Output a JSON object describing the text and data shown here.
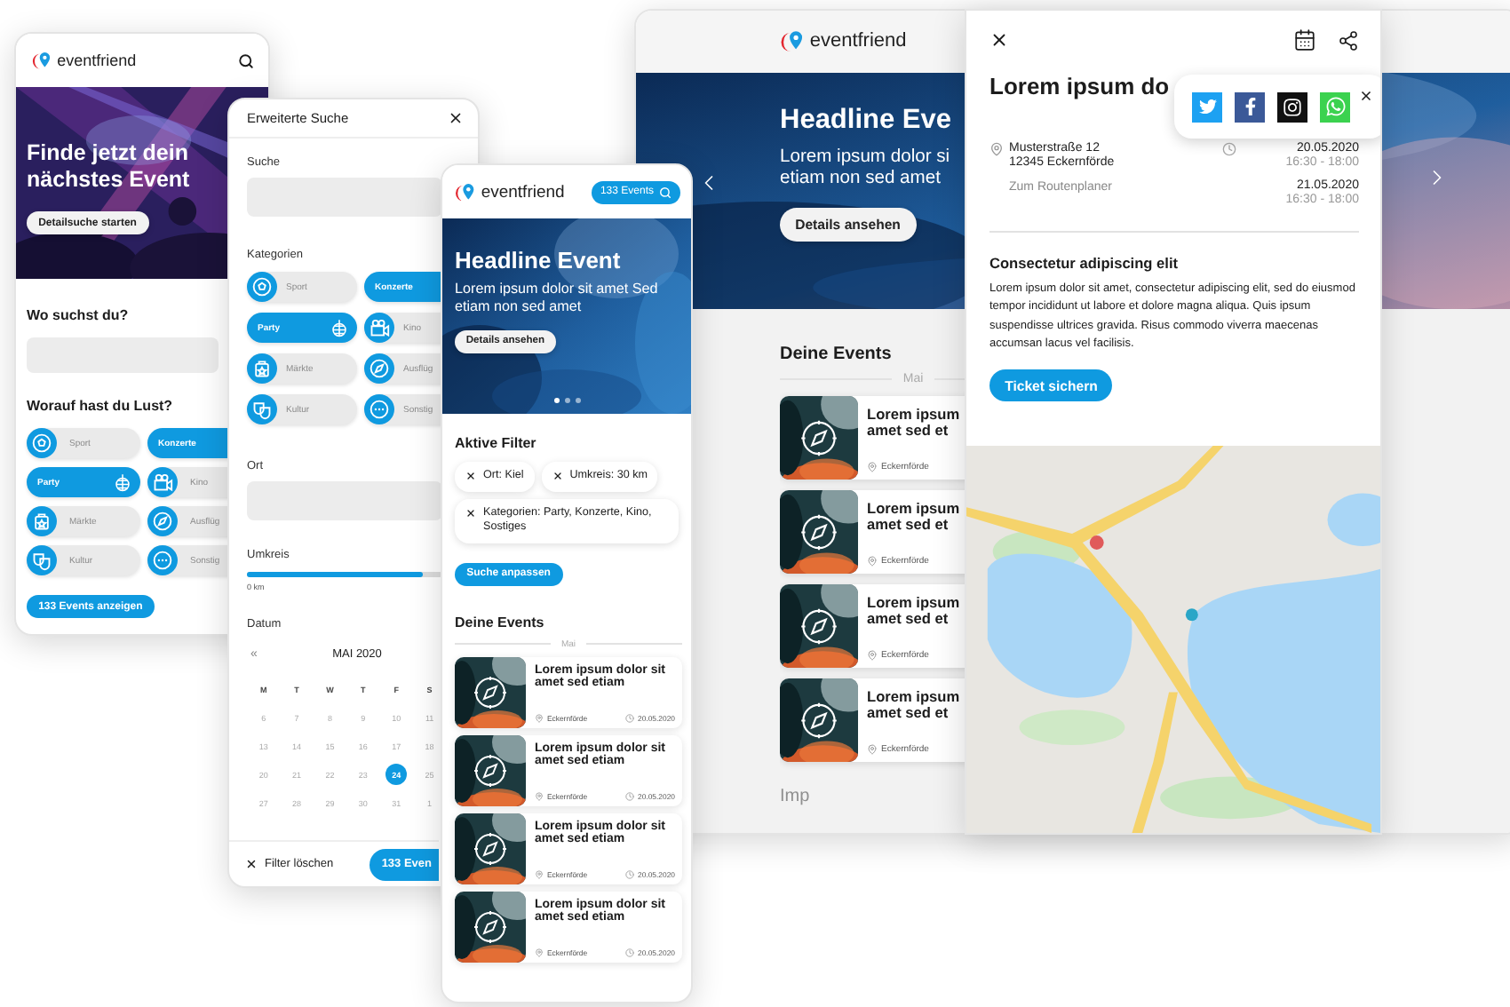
{
  "home_phone": {
    "brand": "eventfriend",
    "hero": {
      "headline": "Finde jetzt dein nächstes Event",
      "button": "Detailsuche starten"
    },
    "location_heading": "Wo suchst du?",
    "interest_heading": "Worauf hast du Lust?",
    "categories": [
      {
        "label": "Sport",
        "selected": false
      },
      {
        "label": "Konzerte",
        "selected": true
      },
      {
        "label": "Party",
        "selected": true
      },
      {
        "label": "Kino",
        "selected": false
      },
      {
        "label": "Märkte",
        "selected": false
      },
      {
        "label": "Ausflüg",
        "selected": false
      },
      {
        "label": "Kultur",
        "selected": false
      },
      {
        "label": "Sonstig",
        "selected": false
      }
    ],
    "results_button": "133 Events anzeigen"
  },
  "search_panel": {
    "title": "Erweiterte Suche",
    "search_label": "Suche",
    "categories_label": "Kategorien",
    "categories": [
      {
        "label": "Sport",
        "selected": false
      },
      {
        "label": "Konzerte",
        "selected": true
      },
      {
        "label": "Party",
        "selected": true
      },
      {
        "label": "Kino",
        "selected": false
      },
      {
        "label": "Märkte",
        "selected": false
      },
      {
        "label": "Ausflüg",
        "selected": false
      },
      {
        "label": "Kultur",
        "selected": false
      },
      {
        "label": "Sonstig",
        "selected": false
      }
    ],
    "place_label": "Ort",
    "radius_label": "Umkreis",
    "radius": {
      "level": 0.9,
      "reading": "0 km"
    },
    "date_label": "Datum",
    "calendar": {
      "prev": "«",
      "month": "MAI 2020",
      "weekdays": [
        "M",
        "T",
        "W",
        "T",
        "F",
        "S"
      ],
      "weeks": [
        [
          {
            "day": "6",
            "selected": false
          },
          {
            "day": "7",
            "selected": false
          },
          {
            "day": "8",
            "selected": false
          },
          {
            "day": "9",
            "selected": false
          },
          {
            "day": "10",
            "selected": false
          },
          {
            "day": "11",
            "selected": false
          }
        ],
        [
          {
            "day": "13",
            "selected": false
          },
          {
            "day": "14",
            "selected": false
          },
          {
            "day": "15",
            "selected": false
          },
          {
            "day": "16",
            "selected": false
          },
          {
            "day": "17",
            "selected": false
          },
          {
            "day": "18",
            "selected": false
          }
        ],
        [
          {
            "day": "20",
            "selected": false
          },
          {
            "day": "21",
            "selected": false
          },
          {
            "day": "22",
            "selected": false
          },
          {
            "day": "23",
            "selected": false
          },
          {
            "day": "24",
            "selected": true
          },
          {
            "day": "25",
            "selected": false
          }
        ],
        [
          {
            "day": "27",
            "selected": false
          },
          {
            "day": "28",
            "selected": false
          },
          {
            "day": "29",
            "selected": false
          },
          {
            "day": "30",
            "selected": false
          },
          {
            "day": "31",
            "selected": false
          },
          {
            "day": "1",
            "selected": false
          }
        ]
      ]
    },
    "clear_button": "Filter löschen",
    "results_button": "133 Even"
  },
  "list_phone": {
    "brand": "eventfriend",
    "events_button": "133 Events",
    "hero": {
      "headline": "Headline Event",
      "text": "Lorem ipsum dolor sit amet Sed etiam non sed amet",
      "button": "Details ansehen",
      "slides": [
        {
          "selected": true
        },
        {
          "selected": false
        },
        {
          "selected": false
        }
      ]
    },
    "filters_heading": "Aktive Filter",
    "filters": [
      "Ort: Kiel",
      "Umkreis: 30 km",
      "Kategorien: Party, Konzerte, Kino, Sostiges"
    ],
    "adjust_button": "Suche anpassen",
    "events_heading": "Deine Events",
    "month": "Mai",
    "events": [
      {
        "title": "Lorem ipsum dolor sit amet sed etiam",
        "place": "Eckernförde",
        "date": "20.05.2020"
      },
      {
        "title": "Lorem ipsum dolor sit amet sed etiam",
        "place": "Eckernförde",
        "date": "20.05.2020"
      },
      {
        "title": "Lorem ipsum dolor sit amet sed etiam",
        "place": "Eckernförde",
        "date": "20.05.2020"
      },
      {
        "title": "Lorem ipsum dolor sit amet sed etiam",
        "place": "Eckernförde",
        "date": "20.05.2020"
      }
    ]
  },
  "tablet": {
    "brand": "eventfriend",
    "hero": {
      "headline": "Headline Eve",
      "text_lines": [
        "Lorem ipsum dolor si",
        "etiam non sed amet"
      ],
      "button": "Details ansehen"
    },
    "events_heading": "Deine Events",
    "month": "Mai",
    "events": [
      {
        "title_lines": [
          "Lorem ipsum",
          "amet sed et"
        ],
        "place": "Eckernförde"
      },
      {
        "title_lines": [
          "Lorem ipsum",
          "amet sed et"
        ],
        "place": "Eckernförde"
      },
      {
        "title_lines": [
          "Lorem ipsum",
          "amet sed et"
        ],
        "place": "Eckernförde"
      },
      {
        "title_lines": [
          "Lorem ipsum",
          "amet sed et"
        ],
        "place": "Eckernförde"
      }
    ],
    "footer": "Imp"
  },
  "detail": {
    "title": "Lorem ipsum do",
    "share": [
      {
        "kind": "twitter"
      },
      {
        "kind": "facebook"
      },
      {
        "kind": "instagram"
      },
      {
        "kind": "whatsapp"
      }
    ],
    "address": [
      "Musterstraße 12",
      "12345 Eckernförde"
    ],
    "route_link": "Zum Routenplaner",
    "dates": [
      {
        "date": "20.05.2020",
        "time": "16:30 - 18:00"
      },
      {
        "date": "21.05.2020",
        "time": "16:30 - 18:00"
      }
    ],
    "heading": "Consectetur adipiscing elit",
    "text": "Lorem ipsum dolor sit amet, consectetur adipiscing elit, sed do eiusmod tempor incididunt ut labore et dolore magna aliqua. Quis ipsum suspendisse ultrices gravida. Risus commodo viverra maecenas accumsan lacus vel facilisis.",
    "ticket_button": "Ticket sichern",
    "map": {
      "kind": "picture"
    }
  }
}
